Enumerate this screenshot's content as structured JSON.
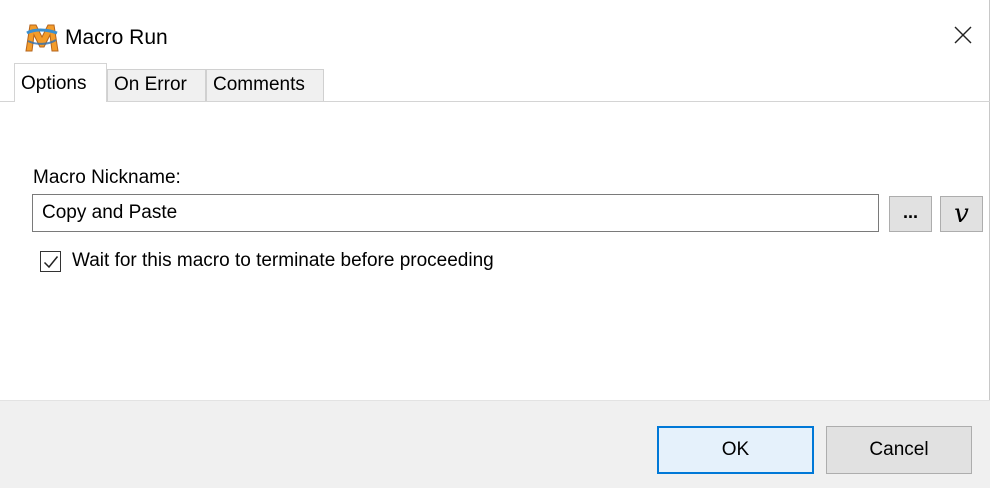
{
  "window": {
    "title": "Macro Run",
    "app_icon": "macro-scheduler-icon",
    "close_icon": "close-icon"
  },
  "tabs": [
    {
      "label": "Options",
      "active": true
    },
    {
      "label": "On Error",
      "active": false
    },
    {
      "label": "Comments",
      "active": false
    }
  ],
  "options": {
    "nickname_label": "Macro Nickname:",
    "nickname_value": "Copy and Paste",
    "browse_label": "...",
    "variable_label": "v",
    "wait_checkbox": {
      "label": "Wait for this macro to terminate before proceeding",
      "checked": true
    }
  },
  "buttons": {
    "ok_label": "OK",
    "cancel_label": "Cancel"
  },
  "colors": {
    "accent": "#0078d7",
    "button_face": "#e1e1e1",
    "footer_bg": "#f0f0f0"
  }
}
